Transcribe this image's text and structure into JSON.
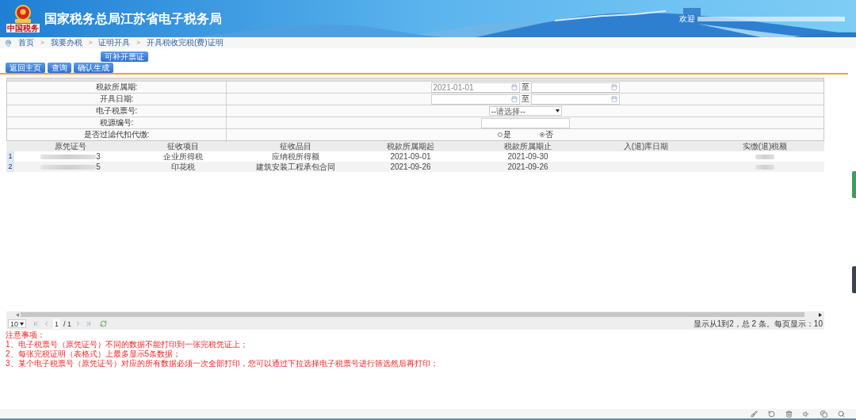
{
  "header": {
    "logo_text": "中国税务",
    "title": "国家税务总局江苏省电子税务局",
    "welcome": "欢迎"
  },
  "breadcrumb": {
    "separator": ">",
    "items": [
      "首页",
      "我要办税",
      "证明开具",
      "开具税收完税(费)证明"
    ]
  },
  "tab_button": "可补开票证",
  "actions": [
    "返回主页",
    "查询",
    "确认生成"
  ],
  "form": {
    "rows": [
      {
        "kind": "date_range",
        "label": "税款所属期:",
        "from": "2021-01-01",
        "to_label": "至"
      },
      {
        "kind": "date_range",
        "label": "开具日期:",
        "to_label": "至"
      },
      {
        "kind": "select",
        "label": "电子税票号:",
        "value": "--请选择--"
      },
      {
        "kind": "text",
        "label": "税源编号:"
      },
      {
        "kind": "radio",
        "label": "是否过滤代扣代缴:",
        "options": [
          {
            "label": "是",
            "selected": false
          },
          {
            "label": "否",
            "selected": true
          }
        ]
      }
    ]
  },
  "table": {
    "columns": [
      "原凭证号",
      "征收项目",
      "征收品目",
      "税款所属期起",
      "税款所属期止",
      "入(退)库日期",
      "实缴(退)税额"
    ],
    "rows": [
      {
        "number": "1",
        "voucher_end": "3",
        "item": "企业所得税",
        "subitem": "应纳税所得额",
        "period_start": "2021-09-01",
        "period_end": "2021-09-30"
      },
      {
        "number": "2",
        "voucher_end": "5",
        "item": "印花税",
        "subitem": "建筑安装工程承包合同",
        "period_start": "2021-09-26",
        "period_end": "2021-09-26"
      }
    ]
  },
  "pager": {
    "page_size": "10",
    "page": "1",
    "pages": "/ 1",
    "summary": "显示从1到2，总 2 条。每页显示：10"
  },
  "notes": {
    "title": "注意事项：",
    "items": [
      "1、电子税票号（原凭证号）不同的数据不能打印到一张完税凭证上；",
      "2、每张完税证明（表格式）上最多显示5条数据；",
      "3、某个电子税票号（原凭证号）对应的所有数据必须一次全部打印，您可以通过下拉选择电子税票号进行筛选然后再打印；"
    ]
  }
}
